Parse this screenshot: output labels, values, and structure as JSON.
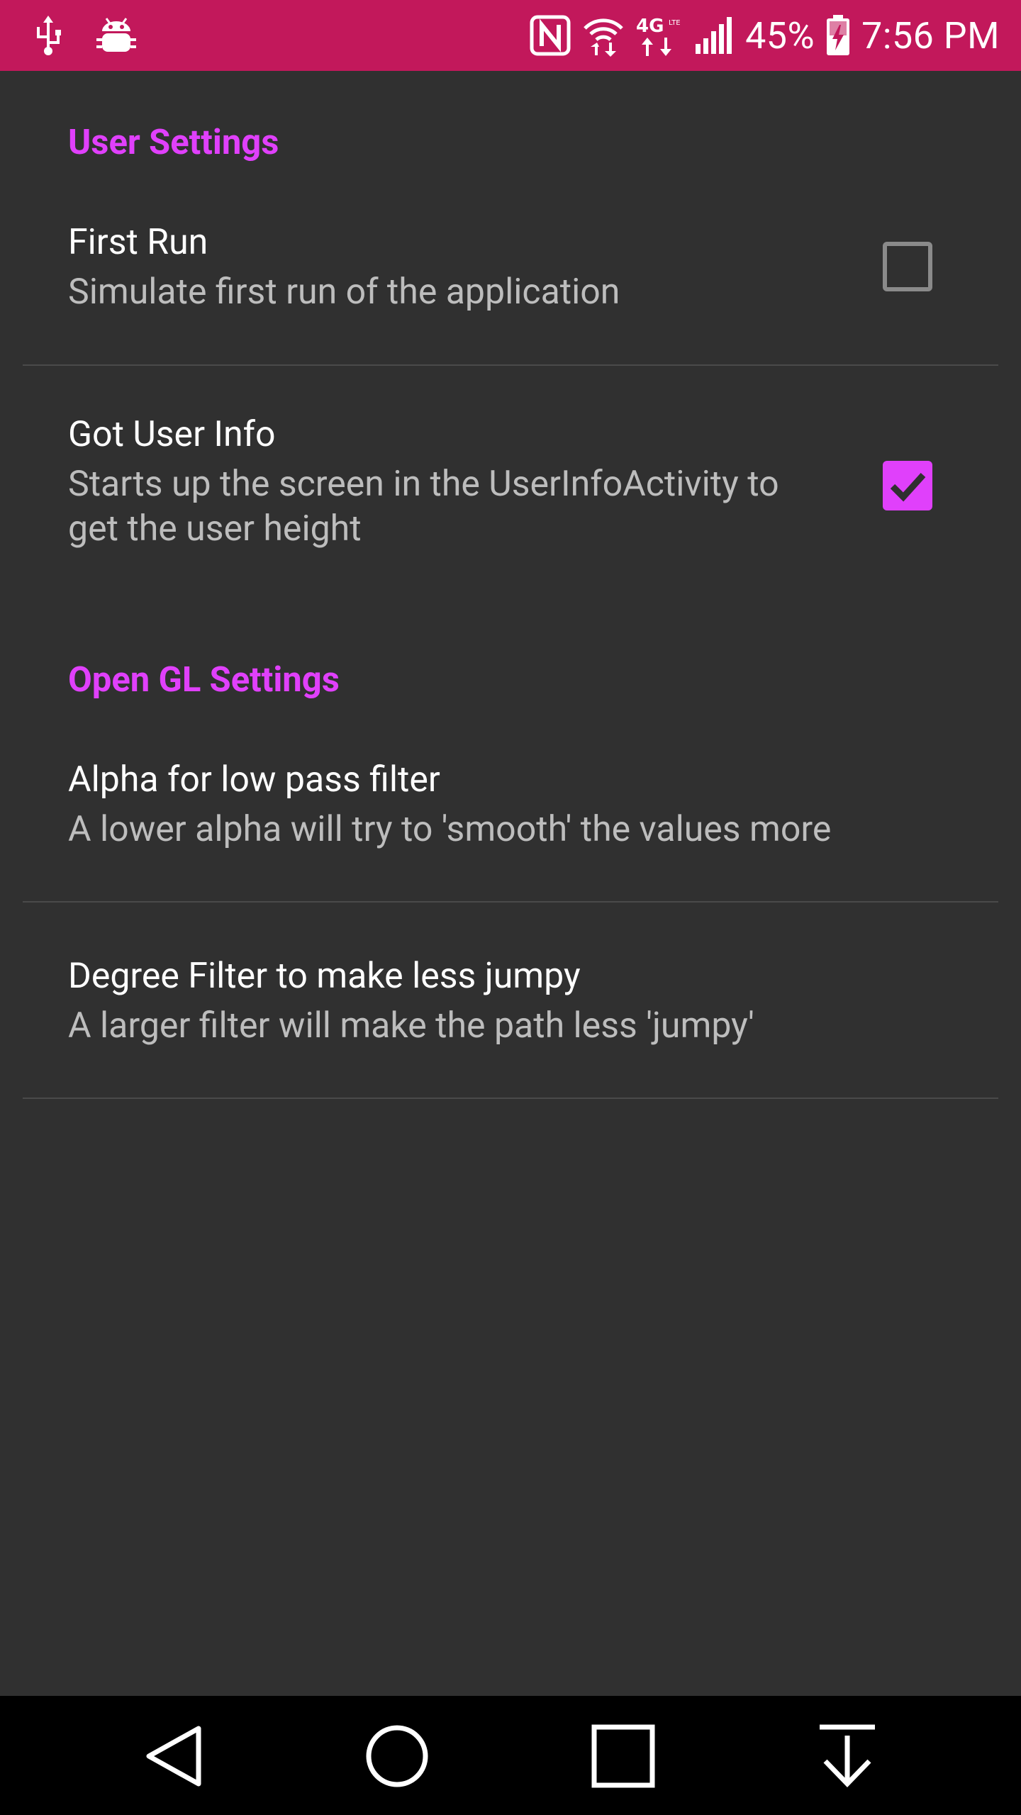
{
  "status_bar": {
    "battery_percent": "45%",
    "time": "7:56 PM",
    "network": "4G LTE",
    "bg_color": "#c2185b",
    "left_icons": [
      "usb-icon",
      "android-debug-icon"
    ],
    "right_icons": [
      "nfc-icon",
      "wifi-icon",
      "network-4g-icon",
      "signal-icon",
      "battery-charging-icon"
    ]
  },
  "accent_color": "#e040fb",
  "categories": [
    {
      "title": "User Settings",
      "items": [
        {
          "title": "First Run",
          "summary": "Simulate first run of the application",
          "checked": false
        },
        {
          "title": "Got User Info",
          "summary": "Starts up the screen in the UserInfoActivity to get the user height",
          "checked": true
        }
      ]
    },
    {
      "title": "Open GL Settings",
      "items": [
        {
          "title": "Alpha for low pass filter",
          "summary": "A lower alpha will try to 'smooth' the values more"
        },
        {
          "title": "Degree Filter to make less jumpy",
          "summary": "A larger filter will make the path less 'jumpy'"
        }
      ]
    }
  ],
  "nav_bar": {
    "buttons": [
      "back-icon",
      "home-icon",
      "recents-icon",
      "notification-pull-icon"
    ]
  }
}
